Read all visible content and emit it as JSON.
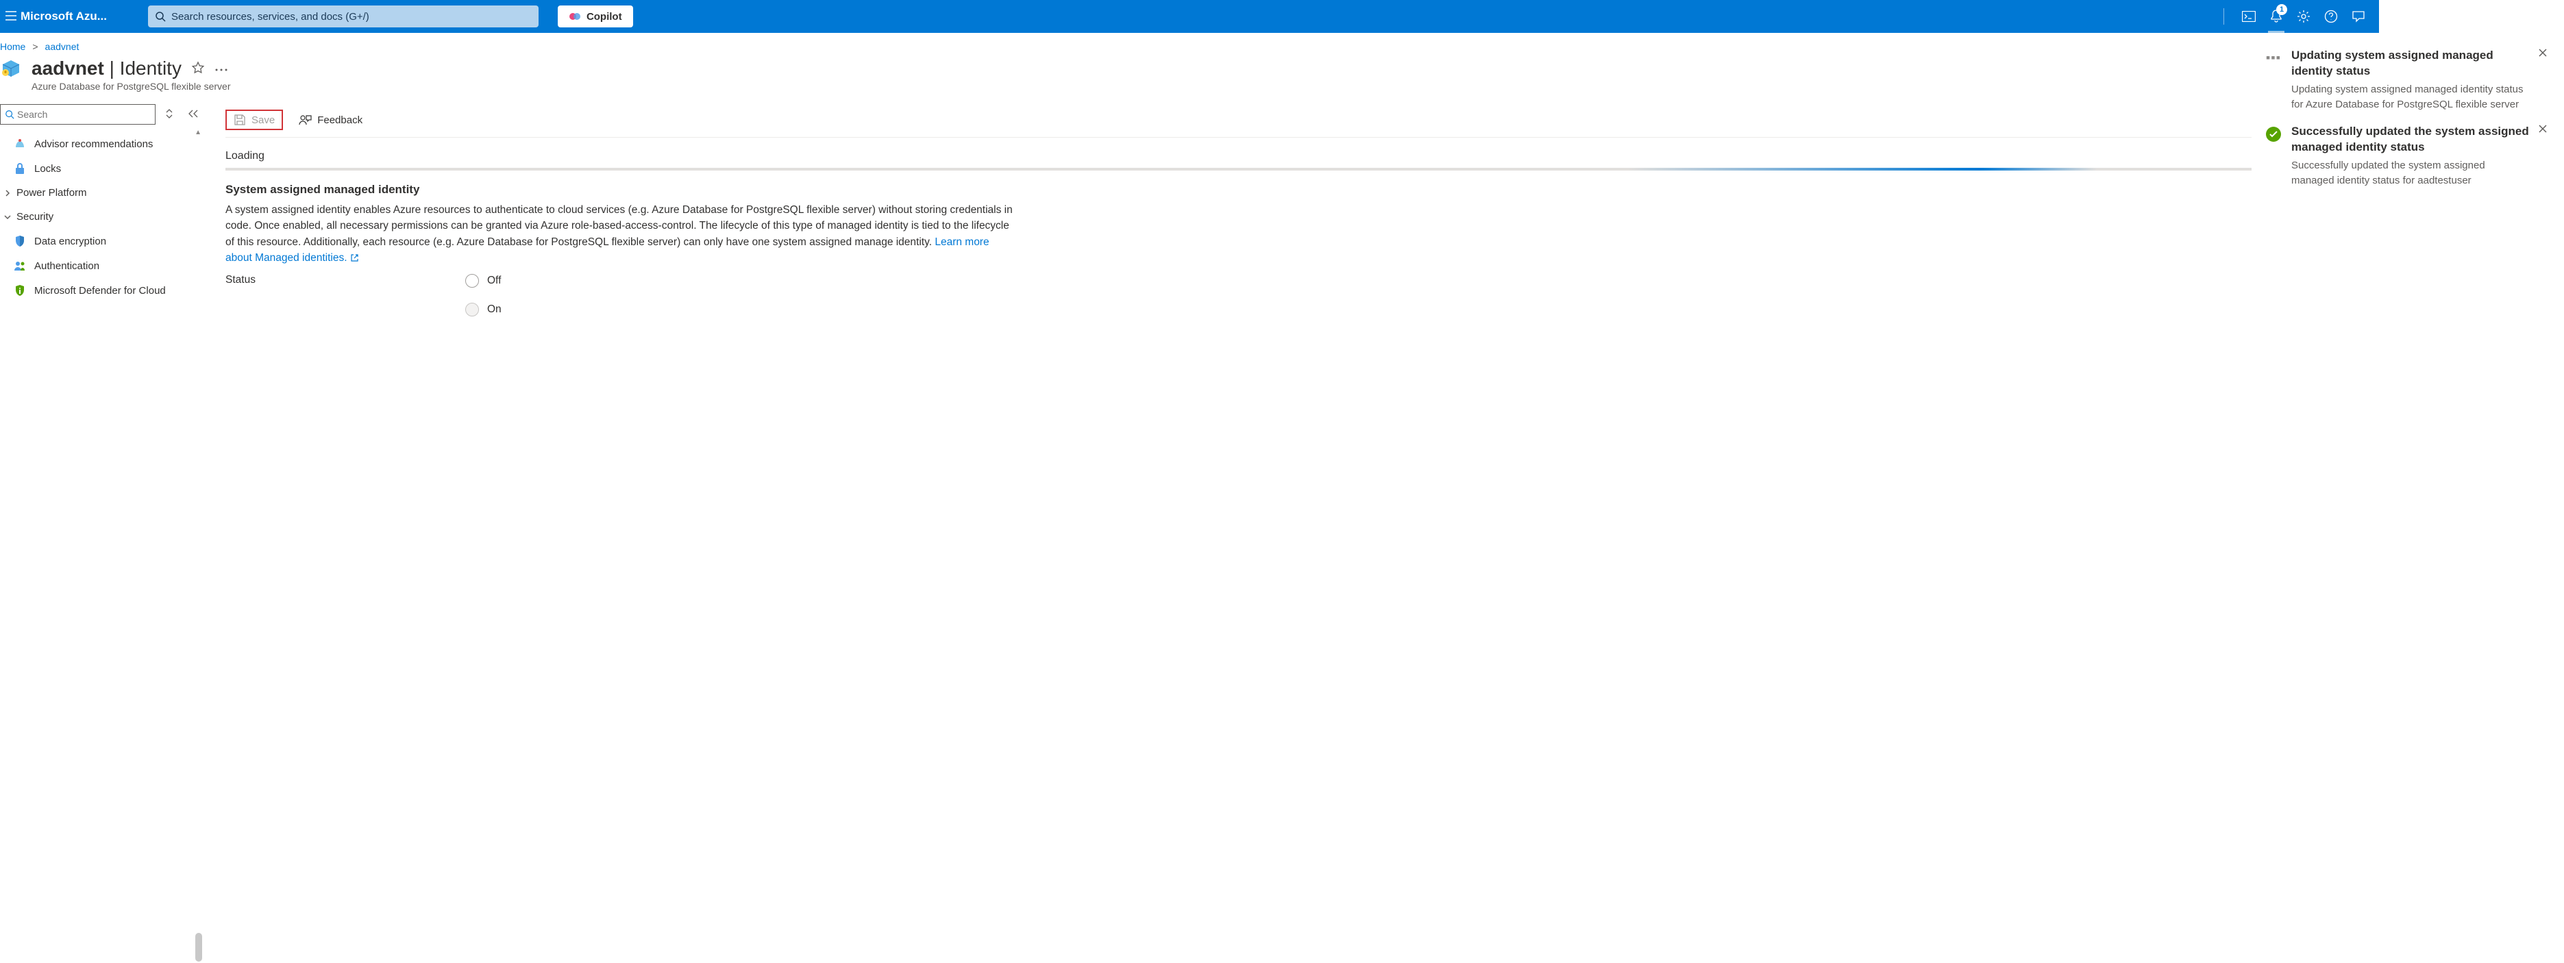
{
  "header": {
    "brand": "Microsoft Azu...",
    "search_placeholder": "Search resources, services, and docs (G+/)",
    "copilot": "Copilot",
    "notification_count": "1"
  },
  "breadcrumb": {
    "home": "Home",
    "current": "aadvnet"
  },
  "title": {
    "name": "aadvnet",
    "page": "Identity",
    "subtitle": "Azure Database for PostgreSQL flexible server"
  },
  "sidebar": {
    "search_placeholder": "Search",
    "items": {
      "advisor": "Advisor recommendations",
      "locks": "Locks",
      "power_platform": "Power Platform",
      "security": "Security",
      "data_encryption": "Data encryption",
      "authentication": "Authentication",
      "defender": "Microsoft Defender for Cloud"
    }
  },
  "toolbar": {
    "save": "Save",
    "feedback": "Feedback"
  },
  "content": {
    "loading": "Loading",
    "section_title": "System assigned managed identity",
    "section_desc": "A system assigned identity enables Azure resources to authenticate to cloud services (e.g. Azure Database for PostgreSQL flexible server) without storing credentials in code. Once enabled, all necessary permissions can be granted via Azure role-based-access-control. The lifecycle of this type of managed identity is tied to the lifecycle of this resource. Additionally, each resource (e.g. Azure Database for PostgreSQL flexible server) can only have one system assigned manage identity. ",
    "learn_more": "Learn more about Managed identities.",
    "status_label": "Status",
    "status_off": "Off",
    "status_on": "On"
  },
  "notifications": {
    "n1": {
      "title": "Updating system assigned managed identity status",
      "sub": "Updating system assigned managed identity status for Azure Database for PostgreSQL flexible server"
    },
    "n2": {
      "title": "Successfully updated the system assigned managed identity status",
      "sub": "Successfully updated the system assigned managed identity status for aadtestuser"
    }
  }
}
